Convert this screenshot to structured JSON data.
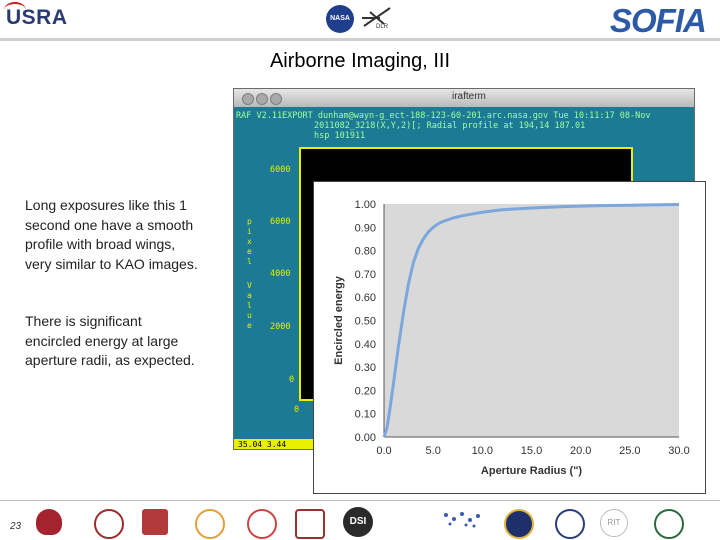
{
  "header": {
    "usra_logo": "USRA",
    "nasa_logo": "NASA",
    "dlr_logo": "DLR",
    "sofia_logo": "SOFIA"
  },
  "slide": {
    "title": "Airborne Imaging, III",
    "paragraphs": [
      "Long exposures like this 1 second one have a smooth profile with broad wings, very similar to KAO images.",
      "There is significant encircled energy at large aperture radii, as expected."
    ],
    "page_number": "23"
  },
  "terminal": {
    "window_title": "irafterm",
    "lines": [
      "RAF V2.11EXPORT dunham@wayn-g_ect-188-123-60-201.arc.nasa.gov Tue 10:11:17 08-Nov",
      "2011082_3218(X,Y,2)[; Radial profile at 194,14 187.01",
      "hsp 101911"
    ],
    "y_ticks": [
      "6000",
      "6000",
      "4000",
      "2000",
      "0"
    ],
    "x_tick": "0",
    "y_axis_letters": "p\ni\nx\ne\nl",
    "y_axis_letters_2": "V\na\nl\nu\ne",
    "status": "35.04    3.44"
  },
  "chart_data": {
    "type": "line",
    "xlabel": "Aperture Radius (\")",
    "ylabel": "Encircled energy",
    "xlim": [
      0,
      30
    ],
    "ylim": [
      0,
      1
    ],
    "x_ticks": [
      "0.0",
      "5.0",
      "10.0",
      "15.0",
      "20.0",
      "25.0",
      "30.0"
    ],
    "y_ticks": [
      "0.00",
      "0.10",
      "0.20",
      "0.30",
      "0.40",
      "0.50",
      "0.60",
      "0.70",
      "0.80",
      "0.90",
      "1.00"
    ],
    "grid": false,
    "background": "#d9d9d9",
    "line_color": "#7ba7dc",
    "series": [
      {
        "x": [
          0.0,
          0.3,
          0.6,
          1.0,
          1.5,
          2.0,
          2.5,
          3.0,
          3.5,
          4.0,
          4.5,
          5.0,
          5.5,
          6.0,
          7.0,
          8.0,
          10.0,
          12.0,
          15.0,
          18.0,
          20.0,
          22.0,
          25.0,
          28.0,
          30.0
        ],
        "y": [
          0.0,
          0.04,
          0.12,
          0.24,
          0.4,
          0.54,
          0.66,
          0.75,
          0.81,
          0.85,
          0.88,
          0.9,
          0.915,
          0.925,
          0.94,
          0.95,
          0.965,
          0.975,
          0.983,
          0.988,
          0.991,
          0.993,
          0.995,
          0.997,
          0.998
        ]
      }
    ]
  },
  "colors": {
    "terminal_bg": "#1d7a94",
    "terminal_plot": "#e8f000",
    "title_text": "#000000"
  }
}
